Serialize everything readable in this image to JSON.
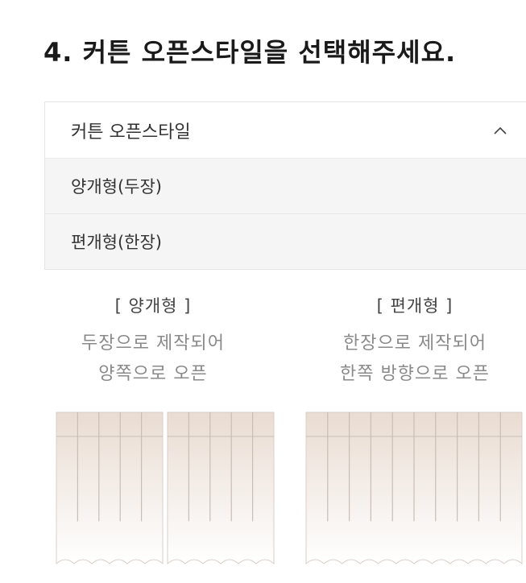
{
  "title": "4. 커튼 오픈스타일을 선택해주세요.",
  "dropdown": {
    "label": "커튼 오픈스타일",
    "expanded": true,
    "options": [
      "양개형(두장)",
      "편개형(한장)"
    ]
  },
  "styles": [
    {
      "heading": "[ 양개형 ]",
      "line1": "두장으로 제작되어",
      "line2": "양쪽으로 오픈"
    },
    {
      "heading": "[ 편개형 ]",
      "line1": "한장으로 제작되어",
      "line2": "한쪽 방향으로 오픈"
    }
  ],
  "colors": {
    "curtain_top": "#e9dcd2",
    "curtain_bottom": "#ffffff",
    "fold_line": "#c9bdb4",
    "border": "#e4e4e4"
  }
}
